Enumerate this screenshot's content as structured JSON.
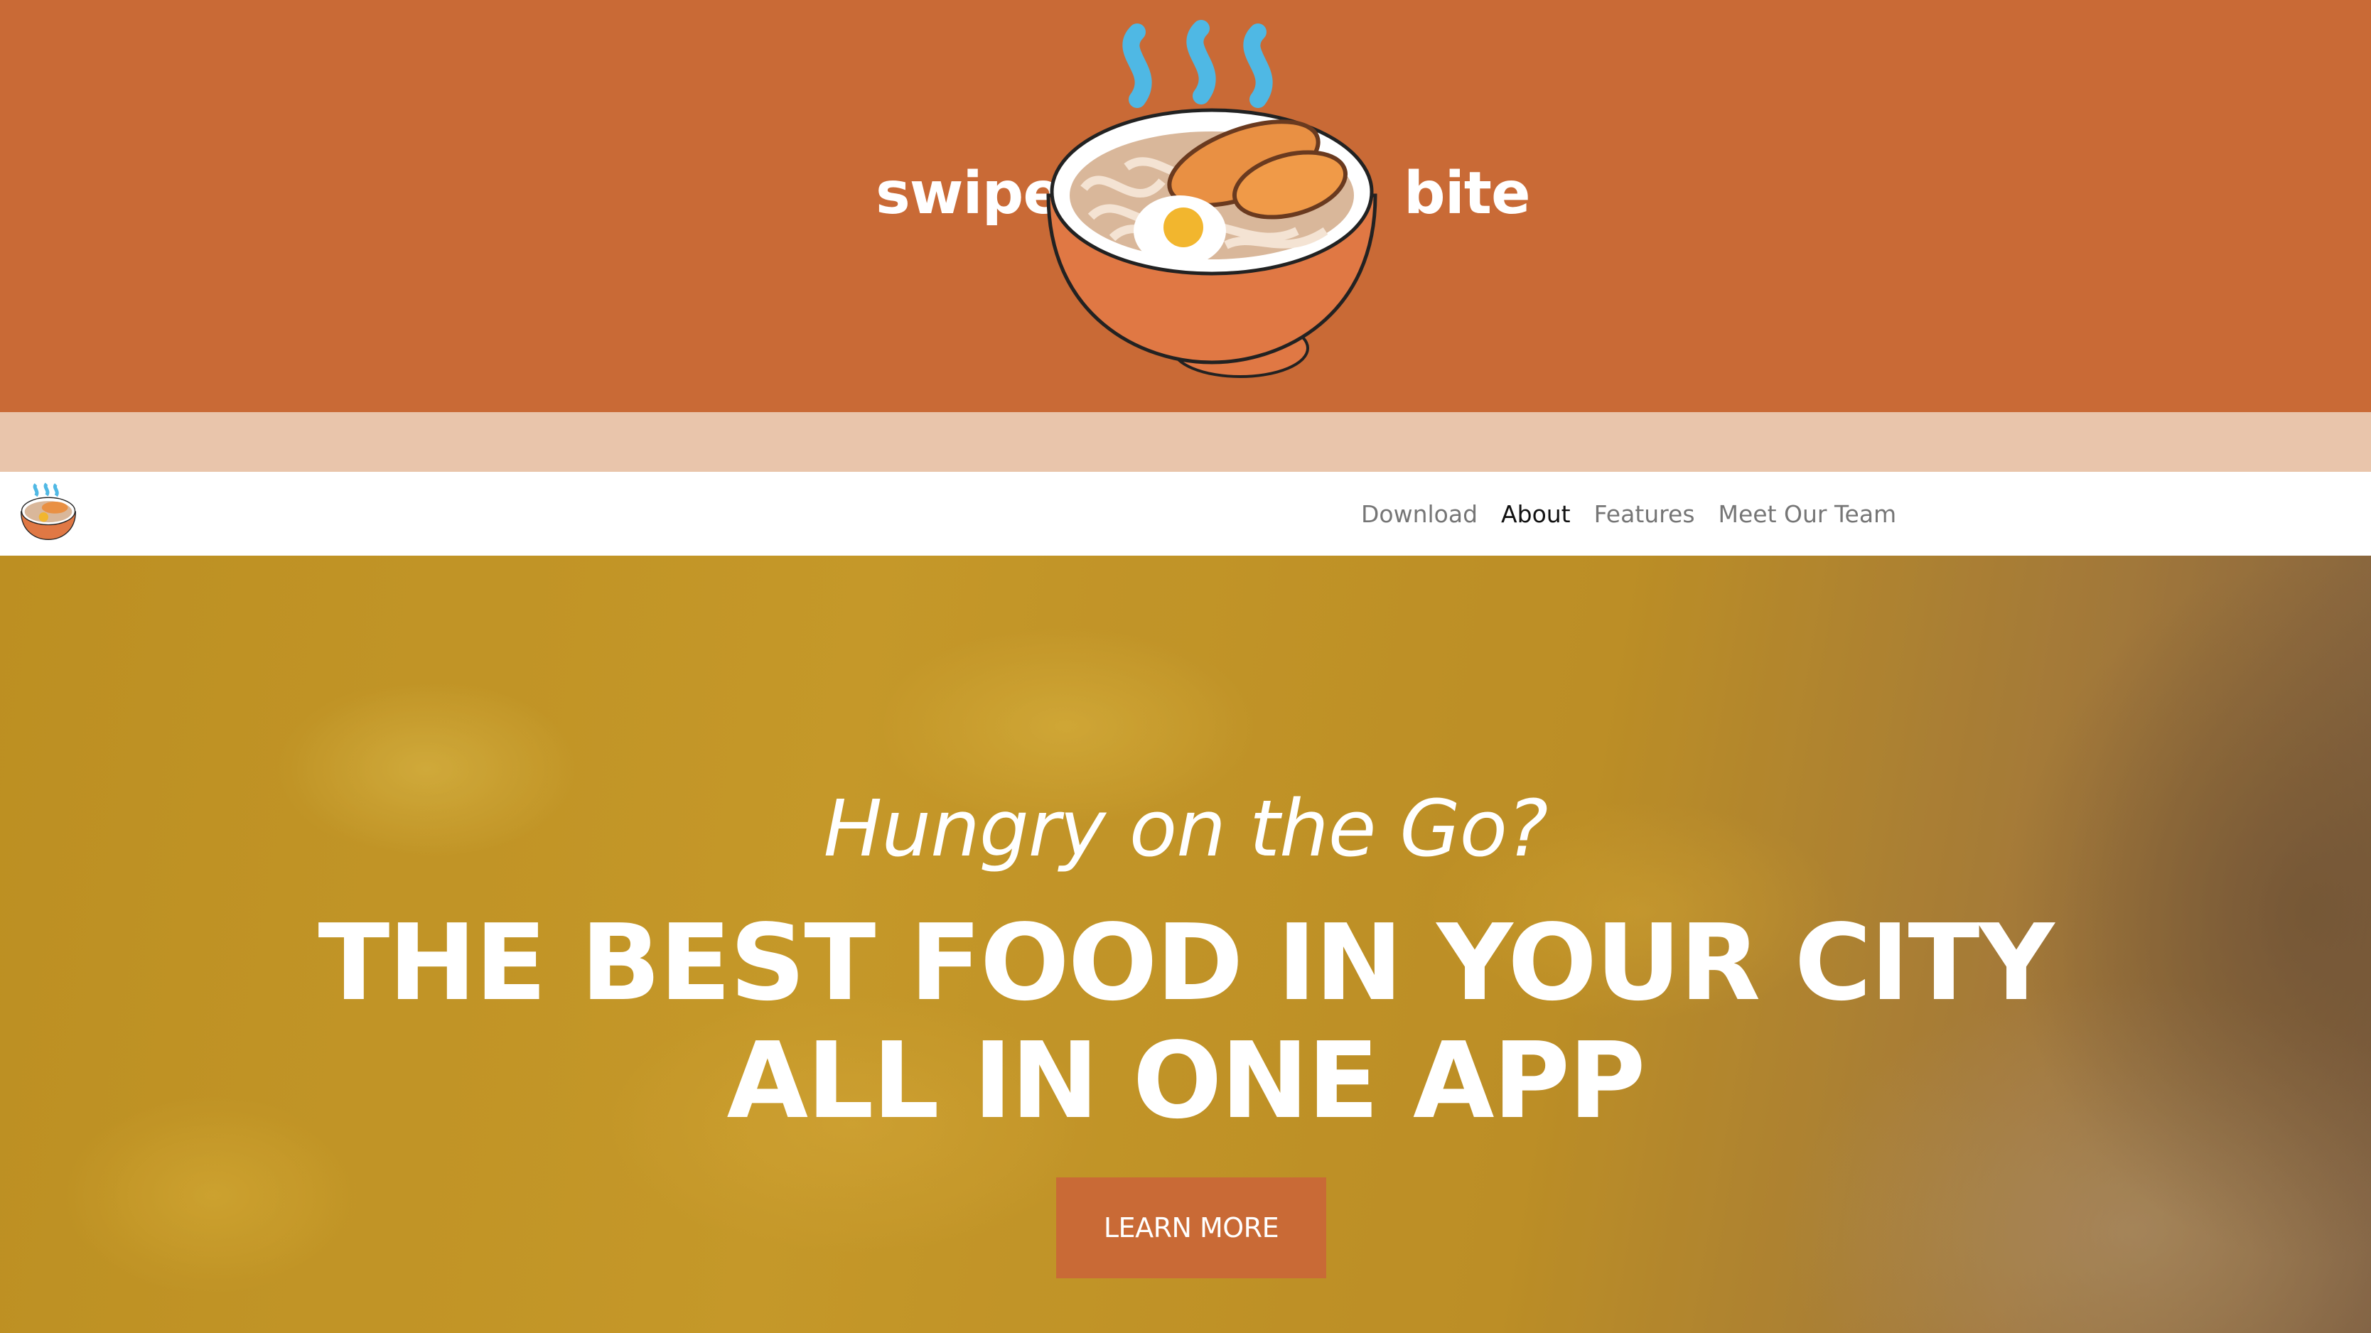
{
  "banner": {
    "brand_left": "swipe",
    "brand_right": "bite",
    "logo_icon": "ramen-bowl-icon",
    "background_color": "#c96a36"
  },
  "strip": {
    "color": "#e9c5ab"
  },
  "navbar": {
    "logo_icon": "ramen-bowl-icon",
    "links": [
      {
        "label": "Download",
        "active": false
      },
      {
        "label": "About",
        "active": true
      },
      {
        "label": "Features",
        "active": false
      },
      {
        "label": "Meet Our Team",
        "active": false
      }
    ]
  },
  "hero": {
    "subtitle": "Hungry on the Go?",
    "title_line1": "THE BEST FOOD IN YOUR CITY",
    "title_line2": "ALL IN ONE APP",
    "cta_label": "LEARN MORE",
    "cta_color": "#c96a36",
    "background_image": "macaroni-and-cheese-photo"
  }
}
